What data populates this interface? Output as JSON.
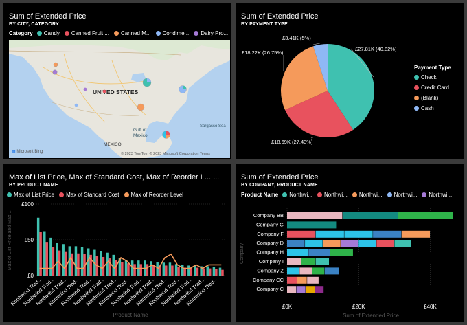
{
  "colors": {
    "teal": "#3fc1b0",
    "red": "#e8525e",
    "orange": "#f59a5b",
    "blue": "#3b82c4",
    "purple": "#a57ad6",
    "green": "#2fb34a",
    "light_blue": "#8fb8f5",
    "pink": "#e9b7c0",
    "dark_teal": "#138a80",
    "cyan": "#2dc3e8"
  },
  "map_panel": {
    "title": "Sum of Extended Price",
    "subtitle": "BY CITY, CATEGORY",
    "legend_title": "Category",
    "legend": [
      {
        "label": "Candy",
        "color": "#3fc1b0"
      },
      {
        "label": "Canned Fruit ...",
        "color": "#e8525e"
      },
      {
        "label": "Canned M...",
        "color": "#f59a5b"
      },
      {
        "label": "Condime...",
        "color": "#8fb8f5"
      },
      {
        "label": "Dairy Pro...",
        "color": "#a57ad6"
      }
    ],
    "labels": {
      "country": "UNITED STATES",
      "gulf": "Gulf of\nMexico",
      "gulf_1": "Gulf of",
      "gulf_2": "Mexico",
      "sea": "Sargasso Sea",
      "mexico": "MEXICO",
      "bing": "Microsoft Bing",
      "credit": "© 2023 TomTom  © 2023 Microsoft Corporation  Terms"
    }
  },
  "pie_panel": {
    "title": "Sum of Extended Price",
    "subtitle": "BY PAYMENT TYPE",
    "legend_title": "Payment Type",
    "chart_data": {
      "type": "pie",
      "slices": [
        {
          "name": "Check",
          "value": 27.81,
          "label": "£27.81K (40.82%)",
          "color": "#3fc1b0"
        },
        {
          "name": "Credit Card",
          "value": 18.69,
          "label": "£18.69K (27.43%)",
          "color": "#e8525e"
        },
        {
          "name": "(Blank)",
          "value": 18.22,
          "label": "£18.22K (26.75%)",
          "color": "#f59a5b"
        },
        {
          "name": "Cash",
          "value": 3.41,
          "label": "£3.41K (5%)",
          "color": "#8fb8f5"
        }
      ]
    }
  },
  "bar_panel": {
    "title": "Max of List Price, Max of Standard Cost, Max of Reorder L...",
    "subtitle": "BY PRODUCT NAME",
    "more": "...",
    "legend": [
      {
        "label": "Max of List Price",
        "color": "#3fc1b0"
      },
      {
        "label": "Max of Standard Cost",
        "color": "#e8525e"
      },
      {
        "label": "Max of Reorder Level",
        "color": "#f59a5b"
      }
    ],
    "y_axis_title": "Max of List Price and Max ...",
    "x_axis_title": "Product Name",
    "chart_data": {
      "type": "bar",
      "category_label": "Northwind Trad...",
      "ylim": [
        0,
        100
      ],
      "yticks": [
        "£0",
        "£50",
        "£100"
      ],
      "series": [
        {
          "name": "Max of List Price",
          "values": [
            81,
            62,
            53,
            46,
            44,
            41,
            41,
            40,
            38,
            36,
            34,
            32,
            29,
            25,
            22,
            21,
            21,
            21,
            20,
            19,
            18,
            18,
            16,
            15,
            14,
            14,
            13,
            13,
            12,
            11
          ]
        },
        {
          "name": "Max of Standard Cost",
          "values": [
            61,
            47,
            40,
            35,
            33,
            31,
            31,
            30,
            29,
            27,
            26,
            24,
            22,
            19,
            17,
            16,
            16,
            16,
            15,
            14,
            14,
            14,
            12,
            11,
            11,
            11,
            10,
            10,
            9,
            8
          ]
        },
        {
          "name": "Max of Reorder Level",
          "values": [
            10,
            10,
            10,
            20,
            10,
            25,
            10,
            10,
            25,
            15,
            10,
            20,
            10,
            25,
            20,
            10,
            10,
            10,
            15,
            10,
            25,
            30,
            15,
            10,
            10,
            15,
            10,
            15,
            15,
            15
          ]
        }
      ]
    }
  },
  "hbar_panel": {
    "title": "Sum of Extended Price",
    "subtitle": "BY COMPANY, PRODUCT NAME",
    "legend_title": "Product Name",
    "legend": [
      {
        "label": "Northwi...",
        "color": "#3fc1b0"
      },
      {
        "label": "Northwi...",
        "color": "#e8525e"
      },
      {
        "label": "Northwi...",
        "color": "#f59a5b"
      },
      {
        "label": "Northwi...",
        "color": "#8fb8f5"
      },
      {
        "label": "Northwi...",
        "color": "#a57ad6"
      }
    ],
    "y_axis_title": "Company",
    "x_axis_title": "Sum of Extended Price",
    "chart_data": {
      "type": "bar",
      "orientation": "horizontal",
      "stacked": true,
      "xlim": [
        0,
        47000
      ],
      "xticks": [
        "£0K",
        "£20K",
        "£40K"
      ],
      "rows": [
        {
          "company": "Company BB",
          "segments": [
            {
              "v": 15500,
              "c": "#e9b7c0"
            },
            {
              "v": 15500,
              "c": "#138a80"
            },
            {
              "v": 15500,
              "c": "#2fb34a"
            }
          ]
        },
        {
          "company": "Company G",
          "segments": [
            {
              "v": 13800,
              "c": "#138a80"
            }
          ]
        },
        {
          "company": "Company F",
          "segments": [
            {
              "v": 8000,
              "c": "#e8525e"
            },
            {
              "v": 8000,
              "c": "#2dc3e8"
            },
            {
              "v": 8000,
              "c": "#2dc3e8"
            },
            {
              "v": 8000,
              "c": "#3b82c4"
            },
            {
              "v": 8000,
              "c": "#f59a5b"
            }
          ]
        },
        {
          "company": "Company D",
          "segments": [
            {
              "v": 5000,
              "c": "#3b82c4"
            },
            {
              "v": 5000,
              "c": "#2dc3e8"
            },
            {
              "v": 5000,
              "c": "#f59a5b"
            },
            {
              "v": 5000,
              "c": "#a57ad6"
            },
            {
              "v": 5000,
              "c": "#2dc3e8"
            },
            {
              "v": 5000,
              "c": "#e8525e"
            },
            {
              "v": 4800,
              "c": "#3fc1b0"
            }
          ]
        },
        {
          "company": "Company H",
          "segments": [
            {
              "v": 6000,
              "c": "#2dc3e8"
            },
            {
              "v": 6000,
              "c": "#3b82c4"
            },
            {
              "v": 6500,
              "c": "#2fb34a"
            }
          ]
        },
        {
          "company": "Company I",
          "segments": [
            {
              "v": 4000,
              "c": "#e9b7c0"
            },
            {
              "v": 4000,
              "c": "#2fb34a"
            },
            {
              "v": 3800,
              "c": "#3fc1b0"
            }
          ]
        },
        {
          "company": "Company Z",
          "segments": [
            {
              "v": 3500,
              "c": "#2dc3e8"
            },
            {
              "v": 3500,
              "c": "#e9b7c0"
            },
            {
              "v": 3500,
              "c": "#2fb34a"
            },
            {
              "v": 4000,
              "c": "#3b82c4"
            }
          ]
        },
        {
          "company": "Company CC",
          "segments": [
            {
              "v": 2800,
              "c": "#e8525e"
            },
            {
              "v": 2800,
              "c": "#f59a5b"
            },
            {
              "v": 3300,
              "c": "#e9b7c0"
            }
          ]
        },
        {
          "company": "Company C",
          "segments": [
            {
              "v": 2600,
              "c": "#e9b7c0"
            },
            {
              "v": 2600,
              "c": "#a57ad6"
            },
            {
              "v": 2600,
              "c": "#e8a800"
            },
            {
              "v": 2500,
              "c": "#8e2b8c"
            }
          ]
        }
      ]
    }
  }
}
